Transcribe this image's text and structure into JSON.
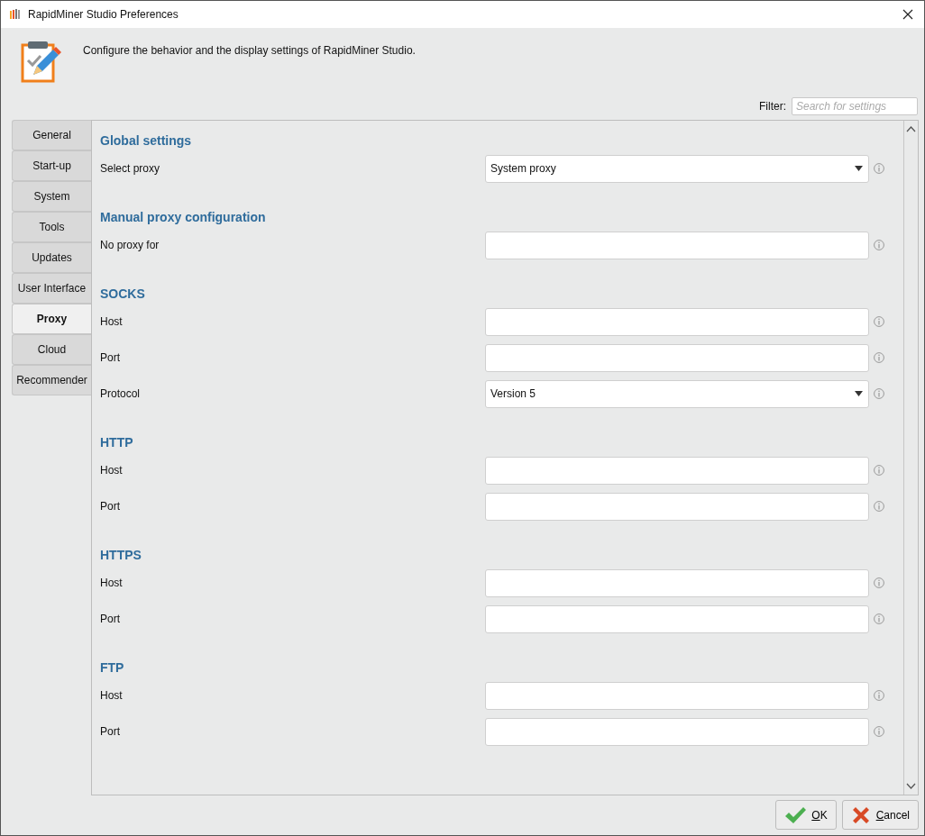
{
  "window": {
    "title": "RapidMiner Studio Preferences"
  },
  "header": {
    "description": "Configure the behavior and the display settings of RapidMiner Studio."
  },
  "filter": {
    "label": "Filter:",
    "placeholder": "Search for settings"
  },
  "tabs": [
    {
      "label": "General",
      "selected": false
    },
    {
      "label": "Start-up",
      "selected": false
    },
    {
      "label": "System",
      "selected": false
    },
    {
      "label": "Tools",
      "selected": false
    },
    {
      "label": "Updates",
      "selected": false
    },
    {
      "label": "User Interface",
      "selected": false
    },
    {
      "label": "Proxy",
      "selected": true
    },
    {
      "label": "Cloud",
      "selected": false
    },
    {
      "label": "Recommender",
      "selected": false
    }
  ],
  "sections": [
    {
      "title": "Global settings",
      "settings": [
        {
          "label": "Select proxy",
          "kind": "dropdown",
          "value": "System proxy"
        }
      ]
    },
    {
      "title": "Manual proxy configuration",
      "settings": [
        {
          "label": "No proxy for",
          "kind": "text"
        }
      ]
    },
    {
      "title": "SOCKS",
      "settings": [
        {
          "label": "Host",
          "kind": "text"
        },
        {
          "label": "Port",
          "kind": "text"
        },
        {
          "label": "Protocol",
          "kind": "dropdown",
          "value": "Version 5"
        }
      ]
    },
    {
      "title": "HTTP",
      "settings": [
        {
          "label": "Host",
          "kind": "text"
        },
        {
          "label": "Port",
          "kind": "text"
        }
      ]
    },
    {
      "title": "HTTPS",
      "settings": [
        {
          "label": "Host",
          "kind": "text"
        },
        {
          "label": "Port",
          "kind": "text"
        }
      ]
    },
    {
      "title": "FTP",
      "settings": [
        {
          "label": "Host",
          "kind": "text"
        },
        {
          "label": "Port",
          "kind": "text"
        }
      ]
    }
  ],
  "buttons": [
    {
      "label": "OK",
      "kind": "ok"
    },
    {
      "label": "Cancel",
      "kind": "cancel"
    }
  ]
}
